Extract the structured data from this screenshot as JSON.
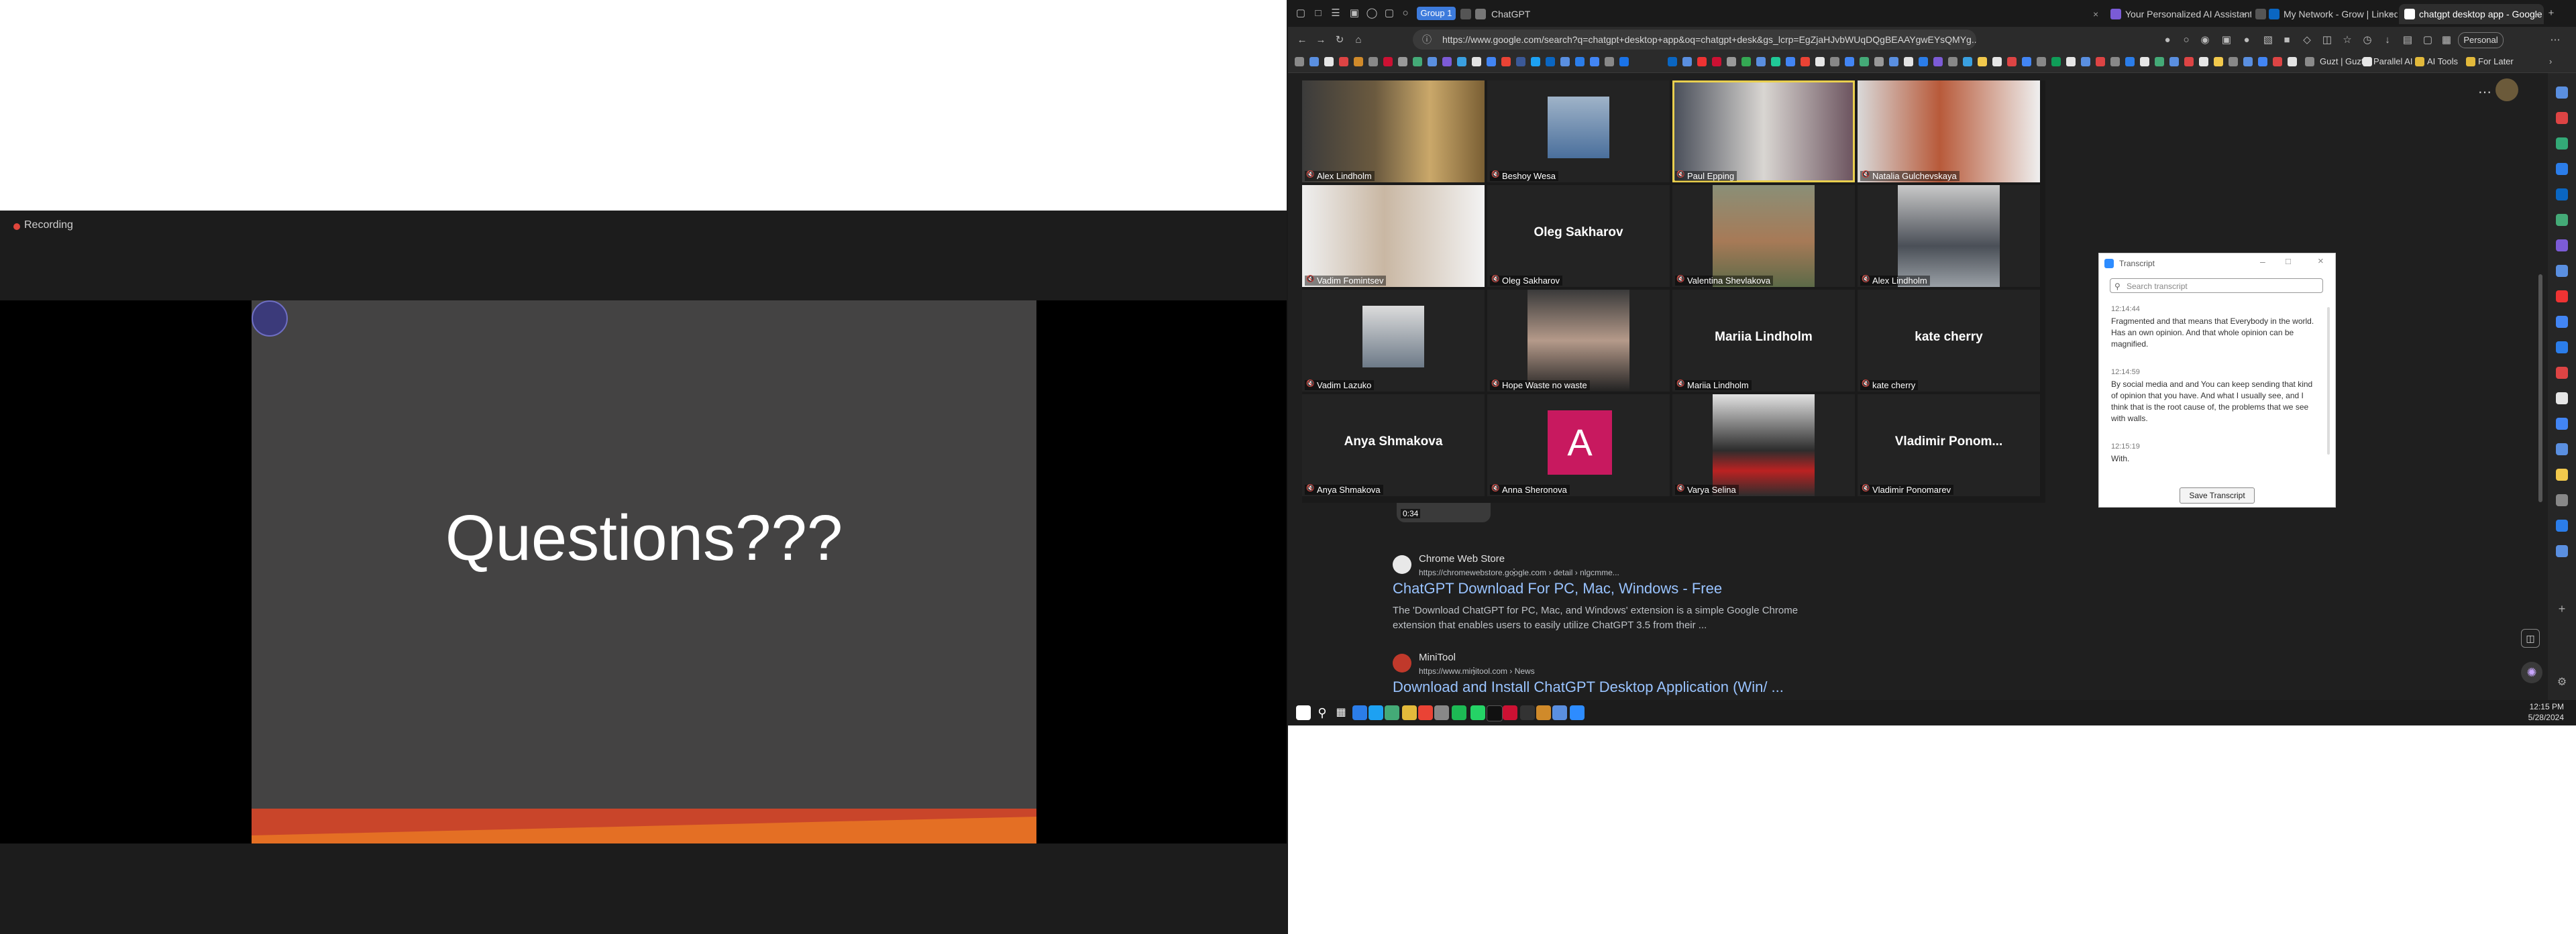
{
  "recording": {
    "label": "Recording"
  },
  "slide": {
    "title": "Questions???"
  },
  "browser": {
    "tabs": [
      {
        "label": "ChatGPT"
      },
      {
        "label": "Your Personalized AI Assistant."
      },
      {
        "label": "My Network - Grow | LinkedIn"
      },
      {
        "label": "chatgpt desktop app - Google S..."
      }
    ],
    "group_label": "Group 1",
    "url": "https://www.google.com/search?q=chatgpt+desktop+app&oq=chatgpt+desk&gs_lcrp=EgZjaHJvbWUqDQgBEAAYgwEYsQMYg...",
    "profile": "Personal",
    "bookmarks": [
      "Guzt | Guzt",
      "Parallel AI",
      "AI Tools",
      "For Later"
    ]
  },
  "results": [
    {
      "site": "Chrome Web Store",
      "url": "https://chromewebstore.google.com › detail › nlgcmme...",
      "title": "ChatGPT Download For PC, Mac, Windows - Free",
      "snippet": "The 'Download ChatGPT for PC, Mac, and Windows' extension is a simple Google Chrome extension that enables users to easily utilize ChatGPT 3.5 from their ..."
    },
    {
      "site": "MiniTool",
      "url": "https://www.minitool.com › News",
      "title": "Download and Install ChatGPT Desktop Application (Win/ ..."
    }
  ],
  "video_duration": "0:34",
  "gallery": [
    {
      "name": "Alex Lindholm",
      "display": ""
    },
    {
      "name": "Beshoy Wesa",
      "display": ""
    },
    {
      "name": "Paul Epping",
      "display": ""
    },
    {
      "name": "Natalia Gulchevskaya",
      "display": ""
    },
    {
      "name": "Vadim Fomintsev",
      "display": ""
    },
    {
      "name": "Oleg Sakharov",
      "display": "Oleg Sakharov"
    },
    {
      "name": "Valentina Shevlakova",
      "display": ""
    },
    {
      "name": "Alex Lindholm",
      "display": ""
    },
    {
      "name": "Vadim Lazuko",
      "display": ""
    },
    {
      "name": "Hope Waste no waste",
      "display": ""
    },
    {
      "name": "Mariia Lindholm",
      "display": "Mariia Lindholm"
    },
    {
      "name": "kate cherry",
      "display": "kate cherry"
    },
    {
      "name": "Anya Shmakova",
      "display": "Anya Shmakova"
    },
    {
      "name": "Anna Sheronova",
      "display": "A"
    },
    {
      "name": "Varya Selina",
      "display": ""
    },
    {
      "name": "Vladimir Ponomarev",
      "display": "Vladimir  Ponom..."
    }
  ],
  "transcript": {
    "title": "Transcript",
    "search_placeholder": "Search transcript",
    "entries": [
      {
        "time": "12:14:44",
        "text": "Fragmented and that means that Everybody in the world. Has an own opinion. And that whole opinion can be magnified."
      },
      {
        "time": "12:14:59",
        "text": "By social media and and You can keep sending that kind of opinion that you have. And what I usually see, and I think that is the root cause of, the problems that we see with walls."
      },
      {
        "time": "12:15:19",
        "text": "With."
      }
    ],
    "save_label": "Save Transcript"
  },
  "clock": {
    "time": "12:15 PM",
    "date": "5/28/2024"
  },
  "colors": {
    "accent_blue": "#3d7bdc",
    "speaker_outline": "#e9cf4e",
    "link": "#99c3ff",
    "slide_bg": "#444343"
  }
}
